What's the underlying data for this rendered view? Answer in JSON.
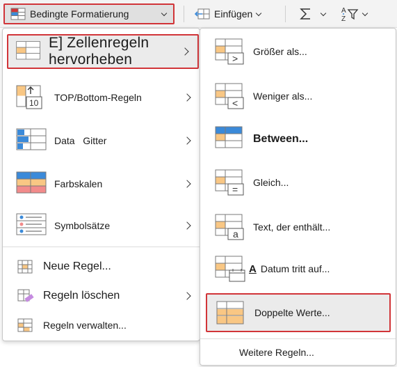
{
  "ribbon": {
    "conditional_formatting_label": "Bedingte Formatierung",
    "insert_label": "Einfügen"
  },
  "menu_main": {
    "highlight_cells_label": "E] Zellenregeln hervorheben",
    "top_bottom_label": "TOP/Bottom-Regeln",
    "data_bars_label": "Data   Gitter",
    "color_scales_label": "Farbskalen",
    "icon_sets_label": "Symbolsätze",
    "new_rule_label": "Neue Regel...",
    "clear_rules_label": "Regeln löschen",
    "manage_rules_label": "Regeln verwalten..."
  },
  "menu_sub": {
    "greater_than_label": "Größer als...",
    "less_than_label": "Weniger als...",
    "between_label": "Between...",
    "equal_to_label": "Gleich...",
    "text_contains_label": "Text, der enthält...",
    "date_occurring_label": "Datum tritt auf...",
    "date_glyph": "A",
    "duplicate_values_label": "Doppelte Werte...",
    "more_rules_label": "Weitere Regeln..."
  },
  "icons": {
    "top_bottom_value": "10",
    "greater_sign": ">",
    "less_sign": "<",
    "equal_sign": "=",
    "text_sign": "a"
  },
  "colors": {
    "highlight_border": "#d13438",
    "orange_fill": "#f9c784",
    "blue_fill": "#3b8ad9",
    "red_fill": "#f28b8b",
    "grid_line": "#7a7a7a"
  }
}
